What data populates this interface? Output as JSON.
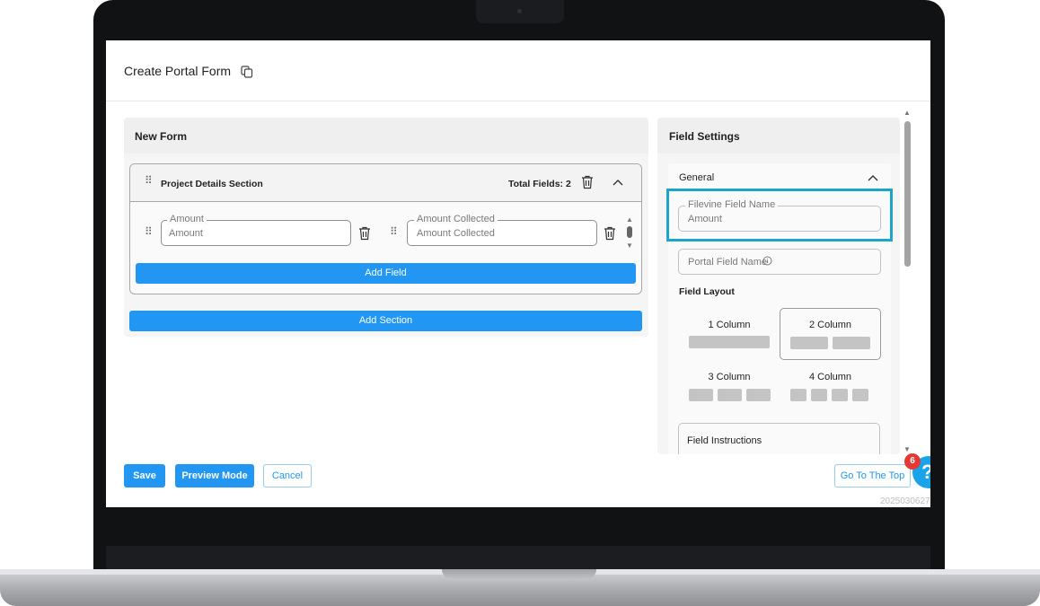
{
  "header": {
    "title": "Create Portal Form"
  },
  "left_panel": {
    "title": "New Form",
    "section": {
      "name": "Project Details Section",
      "total_fields": "Total Fields: 2",
      "fields": [
        {
          "legend": "Amount",
          "value": "Amount"
        },
        {
          "legend": "Amount Collected",
          "value": "Amount Collected"
        }
      ],
      "add_field_label": "Add Field"
    },
    "add_section_label": "Add Section"
  },
  "right_panel": {
    "title": "Field Settings",
    "general_label": "General",
    "filevine_field": {
      "legend": "Filevine Field Name",
      "value": "Amount"
    },
    "portal_field_placeholder": "Portal Field Name",
    "field_layout_label": "Field Layout",
    "layouts": [
      {
        "label": "1 Column",
        "bars": 1,
        "selected": false
      },
      {
        "label": "2 Column",
        "bars": 2,
        "selected": true
      },
      {
        "label": "3 Column",
        "bars": 3,
        "selected": false
      },
      {
        "label": "4 Column",
        "bars": 4,
        "selected": false
      }
    ],
    "field_instructions_label": "Field Instructions"
  },
  "footer": {
    "save_label": "Save",
    "preview_label": "Preview Mode",
    "cancel_label": "Cancel",
    "go_top_label": "Go To The Top",
    "version": "2025030627",
    "badge_count": "6"
  },
  "colors": {
    "primary": "#2196f3",
    "highlight": "#1ba6c9",
    "badge": "#e53935",
    "help": "#1aa3e8"
  }
}
